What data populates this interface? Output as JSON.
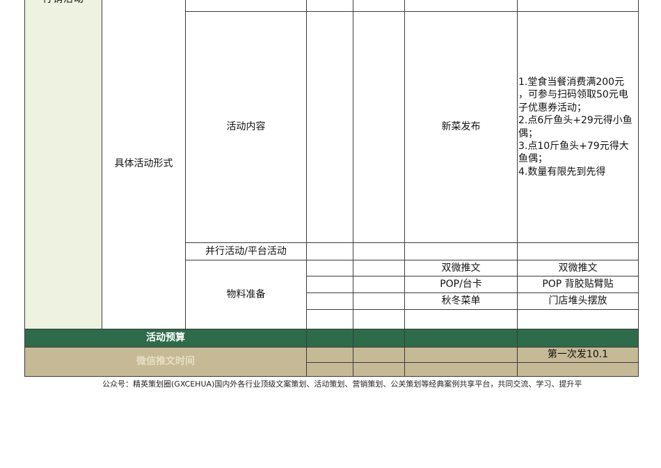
{
  "table": {
    "section_label": "行销活动",
    "activity_form": "具体活动形式",
    "activity_content_label": "活动内容",
    "new_dish_launch": "新菜发布",
    "activity_detail": "1.堂食当餐消费满200元\n，可参与扫码领取50元电\n子优惠券活动；\n2.点6斤鱼头+29元得小鱼\n偶；\n3.点10斤鱼头+79元得大\n鱼偶；\n4.数量有限先到先得",
    "parallel_activity_label": "并行活动/平台活动",
    "materials_label": "物料准备",
    "materials": [
      {
        "item": "双微推文",
        "detail": "双微推文"
      },
      {
        "item": "POP/台卡",
        "detail": "POP 背胶贴臂贴"
      },
      {
        "item": "秋冬菜单",
        "detail": "门店堆头摆放"
      }
    ],
    "budget_label": "活动预算",
    "wechat_time_label": "微信推文时间",
    "wechat_time_value": "第一次发10.1"
  },
  "footer_text": "公众号：精英策划圈(GXCEHUA)国内外各行业顶级文案策划、活动策划、营销策划、公关策划等经典案例共享平台，共同交流、学习、提升平"
}
